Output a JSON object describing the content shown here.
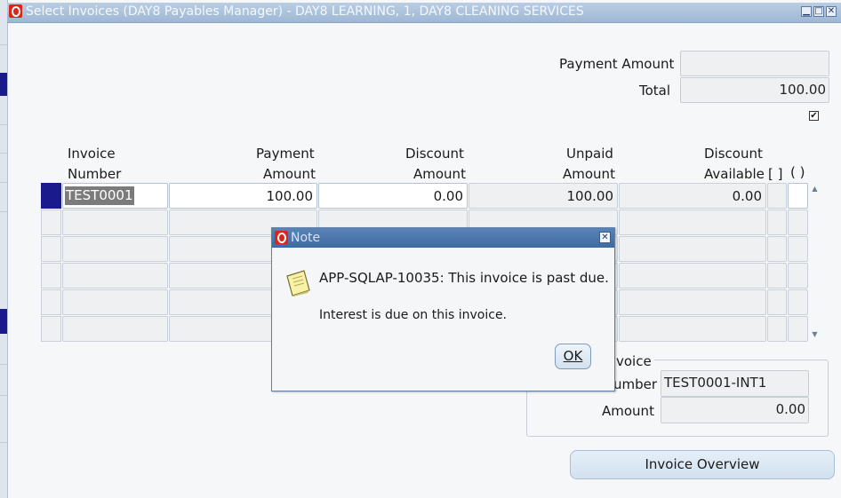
{
  "window": {
    "title": "Select Invoices (DAY8 Payables Manager) - DAY8 LEARNING, 1, DAY8 CLEANING SERVICES",
    "minimize": "▁",
    "maximize": "□",
    "close": "✕"
  },
  "summary": {
    "payment_amount_label": "Payment Amount",
    "payment_amount_value": "",
    "total_label": "Total",
    "total_value": "100.00",
    "checkbox_checked": true,
    "checkbox_mark": "✔"
  },
  "grid": {
    "headers": {
      "invoice_number_1": "Invoice",
      "invoice_number_2": "Number",
      "payment_amount_1": "Payment",
      "payment_amount_2": "Amount",
      "discount_amount_1": "Discount",
      "discount_amount_2": "Amount",
      "unpaid_amount_1": "Unpaid",
      "unpaid_amount_2": "Amount",
      "discount_available_1": "Discount",
      "discount_available_2": "Available",
      "bracket": "[ ]",
      "paren": "( )"
    },
    "rows": [
      {
        "invoice_number": "TEST0001",
        "payment_amount": "100.00",
        "discount_amount": "0.00",
        "unpaid_amount": "100.00",
        "discount_available": "0.00"
      }
    ]
  },
  "interest_invoice": {
    "group_label": "voice",
    "number_label": "umber",
    "number_value": "TEST0001-INT1",
    "amount_label": "Amount",
    "amount_value": "0.00"
  },
  "buttons": {
    "invoice_overview": "Invoice Overview"
  },
  "dialog": {
    "title": "Note",
    "message": "APP-SQLAP-10035: This invoice is past due.",
    "detail": "Interest is due on this invoice.",
    "ok_label": "OK",
    "close": "✕"
  },
  "colors": {
    "title_bar": "#a9c1dc",
    "dialog_title": "#4a76ab",
    "selection": "#1a1a8c",
    "oracle_red": "#d8261b"
  }
}
